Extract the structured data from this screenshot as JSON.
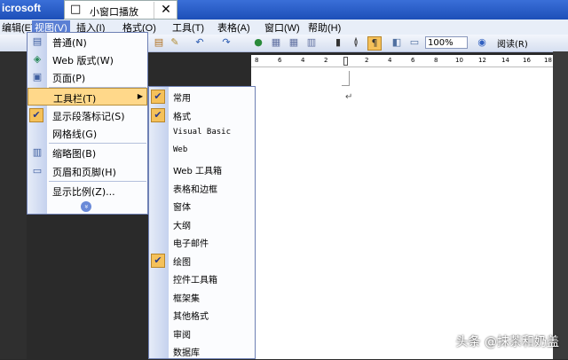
{
  "titlebar": {
    "title": "icrosoft",
    "mini_window": "小窗口播放",
    "close": "✕",
    "mini_icon": "□"
  },
  "menubar": {
    "items": [
      "编辑(E)",
      "视图(V)",
      "插入(I)",
      "格式(O)",
      "工具(T)",
      "表格(A)",
      "窗口(W)",
      "帮助(H)"
    ]
  },
  "toolbar": {
    "zoom": "100%",
    "read_label": "阅读(R)"
  },
  "ruler": {
    "numbers": [
      "8",
      "6",
      "4",
      "2",
      "2",
      "4",
      "6",
      "8",
      "10",
      "12",
      "14",
      "16",
      "18"
    ]
  },
  "view_menu": {
    "items": [
      {
        "label": "普通(N)",
        "icon": "▤"
      },
      {
        "label": "Web 版式(W)",
        "icon": "◈"
      },
      {
        "label": "页面(P)",
        "icon": "▣"
      },
      {
        "label": "工具栏(T)",
        "arrow": "▶"
      },
      {
        "label": "显示段落标记(S)",
        "icon": "✔"
      },
      {
        "label": "网格线(G)"
      },
      {
        "label": "缩略图(B)",
        "icon": "▥"
      },
      {
        "label": "页眉和页脚(H)",
        "icon": "▭"
      },
      {
        "label": "显示比例(Z)..."
      }
    ],
    "more": "»"
  },
  "toolbars_menu": {
    "items": [
      {
        "label": "常用",
        "checked": true
      },
      {
        "label": "格式",
        "checked": true
      },
      {
        "label": "Visual Basic",
        "checked": false
      },
      {
        "label": "Web",
        "checked": false
      },
      {
        "label": "Web 工具箱",
        "checked": false
      },
      {
        "label": "表格和边框",
        "checked": false
      },
      {
        "label": "窗体",
        "checked": false
      },
      {
        "label": "大纲",
        "checked": false
      },
      {
        "label": "电子邮件",
        "checked": false
      },
      {
        "label": "绘图",
        "checked": true
      },
      {
        "label": "控件工具箱",
        "checked": false
      },
      {
        "label": "框架集",
        "checked": false
      },
      {
        "label": "其他格式",
        "checked": false
      },
      {
        "label": "审阅",
        "checked": false
      },
      {
        "label": "数据库",
        "checked": false
      }
    ],
    "check_mark": "✔"
  },
  "doc": {
    "return_mark": "↵"
  },
  "watermark": "头条 @抹茶和奶盖"
}
